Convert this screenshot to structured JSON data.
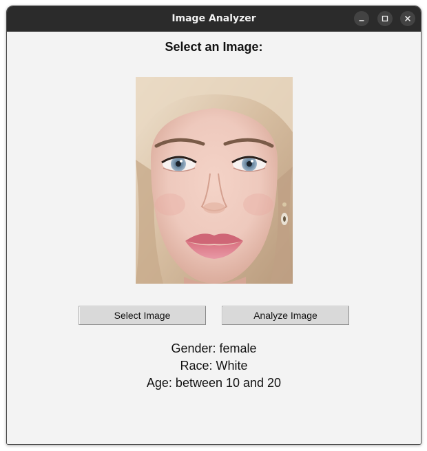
{
  "window": {
    "title": "Image Analyzer",
    "controls": [
      "minimize-icon",
      "maximize-icon",
      "close-icon"
    ]
  },
  "main": {
    "heading": "Select an Image:",
    "image": {
      "subject": "portrait of a young woman with blonde hair and blue eyes",
      "colors": {
        "skin": "#eec9bd",
        "hair": "#d9c2a6",
        "eyes": "#8fa8bd",
        "lips": "#dd8595"
      }
    },
    "buttons": {
      "select_label": "Select Image",
      "analyze_label": "Analyze Image"
    },
    "results": {
      "gender": "Gender: female",
      "race": "Race: White",
      "age": "Age: between 10 and 20"
    }
  },
  "colors": {
    "titlebar": "#2b2b2b",
    "window_bg": "#f3f3f3",
    "button_bg": "#d9d9d9"
  }
}
